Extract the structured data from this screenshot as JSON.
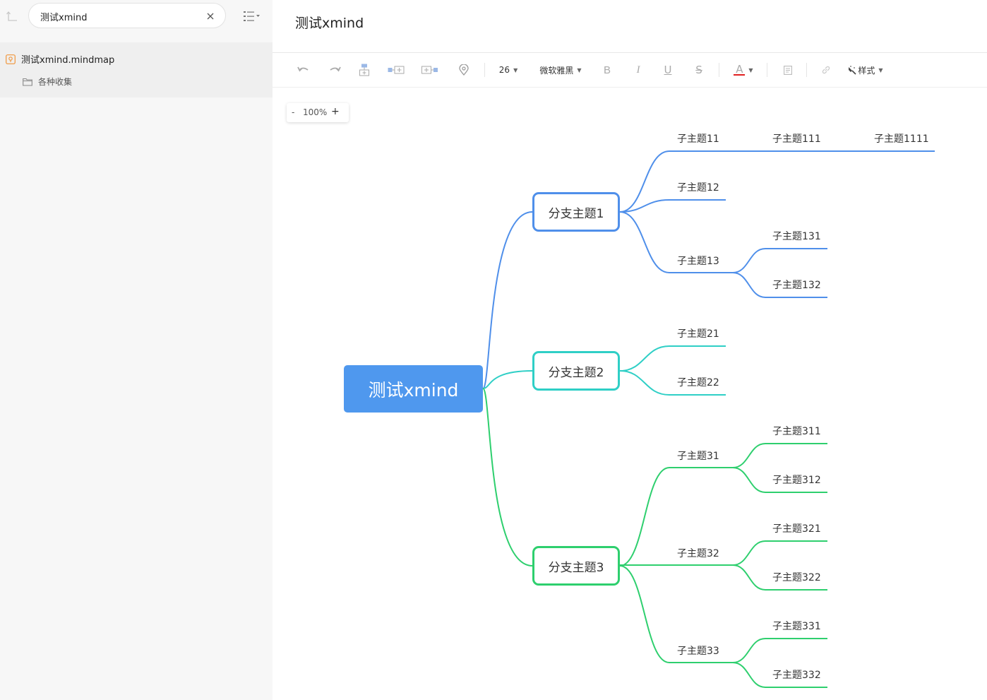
{
  "sidebar": {
    "search_value": "测试xmind",
    "tree": {
      "file_name": "测试xmind.mindmap",
      "folder_name": "各种收集"
    }
  },
  "document": {
    "title": "测试xmind"
  },
  "toolbar": {
    "font_size": "26",
    "font_family": "微软雅黑",
    "bold": "B",
    "italic": "I",
    "underline": "U",
    "strike": "S",
    "text_color_glyph": "A",
    "style_label": "样式",
    "text_color": "#e02020"
  },
  "zoom": {
    "minus": "-",
    "value": "100%",
    "plus": "+"
  },
  "mindmap": {
    "root": "测试xmind",
    "branches": [
      {
        "label": "分支主题1",
        "color": "#4f8fea",
        "children": [
          {
            "label": "子主题11",
            "children": [
              {
                "label": "子主题111",
                "children": [
                  {
                    "label": "子主题1111"
                  }
                ]
              }
            ]
          },
          {
            "label": "子主题12"
          },
          {
            "label": "子主题13",
            "children": [
              {
                "label": "子主题131"
              },
              {
                "label": "子主题132"
              }
            ]
          }
        ]
      },
      {
        "label": "分支主题2",
        "color": "#2fcfc6",
        "children": [
          {
            "label": "子主题21"
          },
          {
            "label": "子主题22"
          }
        ]
      },
      {
        "label": "分支主题3",
        "color": "#2ecf6e",
        "children": [
          {
            "label": "子主题31",
            "children": [
              {
                "label": "子主题311"
              },
              {
                "label": "子主题312"
              }
            ]
          },
          {
            "label": "子主题32",
            "children": [
              {
                "label": "子主题321"
              },
              {
                "label": "子主题322"
              }
            ]
          },
          {
            "label": "子主题33",
            "children": [
              {
                "label": "子主题331"
              },
              {
                "label": "子主题332"
              }
            ]
          }
        ]
      }
    ]
  }
}
